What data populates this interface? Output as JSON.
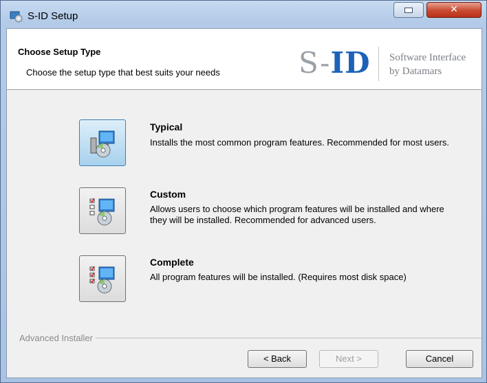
{
  "window": {
    "title": "S-ID Setup"
  },
  "header": {
    "title": "Choose Setup Type",
    "subtitle": "Choose the setup type that best suits your needs",
    "logo_prefix": "S-",
    "logo_id": "ID",
    "logo_tagline_1": "Software Interface",
    "logo_tagline_2": "by Datamars"
  },
  "options": [
    {
      "title": "Typical",
      "description": "Installs the most common program features. Recommended for most users.",
      "selected": true,
      "icon": "install-typical-icon"
    },
    {
      "title": "Custom",
      "description": "Allows users to choose which program features will be installed and where they will be installed. Recommended for advanced users.",
      "selected": false,
      "icon": "install-custom-icon"
    },
    {
      "title": "Complete",
      "description": "All program features will be installed.  (Requires most disk space)",
      "selected": false,
      "icon": "install-complete-icon"
    }
  ],
  "footer": {
    "brand": "Advanced Installer",
    "back_label": "< Back",
    "next_label": "Next >",
    "cancel_label": "Cancel"
  },
  "colors": {
    "accent": "#1c63b8",
    "selected_button": "#a7d1ed",
    "close_button": "#c9492f"
  }
}
